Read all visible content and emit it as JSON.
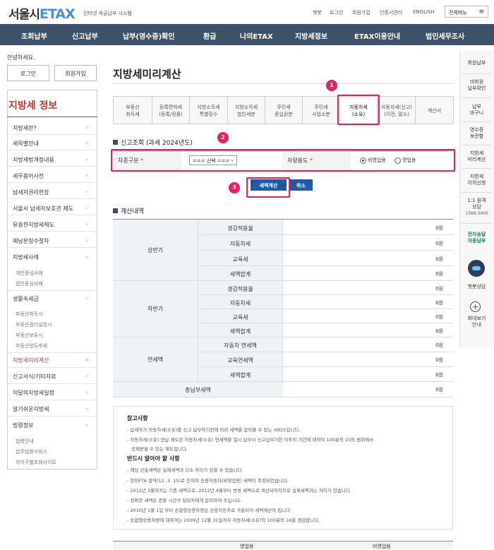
{
  "header": {
    "logo_main": "서울시",
    "logo_etax": "ETAX",
    "logo_sub": "인터넷 세금납부 시스템",
    "links": [
      "챗봇",
      "로그인",
      "회원가입",
      "인증서관리",
      "ENGLISH"
    ],
    "all_menu": "전체메뉴"
  },
  "gnb": [
    "조회납부",
    "신고납부",
    "납부(영수증)확인",
    "환급",
    "나의ETAX",
    "지방세정보",
    "ETAX이용안내",
    "법인세무조사"
  ],
  "sidebar": {
    "greeting": "안녕하세요.",
    "login": "로그인",
    "join": "회원가입",
    "title": "지방세 정보",
    "items": [
      "지방세란?",
      "세목별안내",
      "지방세법개정내용",
      "세무용어사전",
      "납세자권리헌장",
      "서울시 납세자보호관 제도",
      "유용한지방세제도",
      "체납분징수절차",
      "지방세사례"
    ],
    "sub1": [
      "개인중심사례",
      "법인중심사례"
    ],
    "item_living": "생활속세금",
    "sub2": [
      "부동산취득시",
      "부동산권리설정시",
      "부동산보유시",
      "부동산양도후세"
    ],
    "items2": [
      "지방세미리계산",
      "신고서식/기타자료",
      "이달의지방세일정",
      "알기쉬운지방세",
      "법령정보"
    ],
    "sub3": [
      "법령안내",
      "법무법령서비스",
      "자치구별조례사이트"
    ]
  },
  "page": {
    "title": "지방세미리계산",
    "tabs": [
      [
        "부동산",
        "취득세"
      ],
      [
        "등록면허세",
        "(등록/정률)"
      ],
      [
        "지방소득세",
        "특별징수"
      ],
      [
        "지방소득세",
        "법인세분"
      ],
      [
        "주민세",
        "종업원분"
      ],
      [
        "주민세",
        "사업소분"
      ],
      [
        "자동차세",
        "(소유)"
      ],
      [
        "자동차세(신고)",
        "(이전, 말소)"
      ],
      [
        "계산서",
        ""
      ]
    ],
    "badges": [
      "1",
      "2",
      "3"
    ],
    "inquiry_title": "신고조회 (과세 2024년도)",
    "car_type_label": "차종구분",
    "car_type_select": "=== 선택 ===",
    "car_use_label": "차량용도",
    "radio_options": [
      "비영업용",
      "영업용"
    ],
    "calc_btn": "세액계산",
    "cancel_btn": "취소",
    "calc_title": "계산내역",
    "groups": [
      {
        "name": "상반기",
        "rows": [
          "경감적용율",
          "자동차세",
          "교육세",
          "세액합계"
        ]
      },
      {
        "name": "하반기",
        "rows": [
          "경감적용율",
          "자동차세",
          "교육세",
          "세액합계"
        ]
      },
      {
        "name": "연세액",
        "rows": [
          "자동차 연세액",
          "교육연세액",
          "세액합계"
        ]
      }
    ],
    "total_label": "총납부세액",
    "zero": "0원",
    "notes_title": "참고사항",
    "notes": [
      "납세자가 자동차세(소유)를 신고 납부하기전에 미리 세액을 알아볼 수 있는 서비스입니다.",
      "자동차세(소유) 연납 제도란 자동차세(소유) 연세액을 일시 납부시 신고납부기한 이후의 기간에 대하여 100분의 10의 범위에서",
      "공제받을 수 있는 제도입니다."
    ],
    "notes2_title": "반드시 알아야 할 사항",
    "notes2": [
      "해당 산출세액은 실제세액과 다소 차이가 있을 수 있습니다.",
      "한미FTA 협약(12. 3. 15)로 인하여 승용자동차(비영업용) 세액이 조정되었습니다.",
      "2012년 3월까지는 기존 세액으로, 2012년 4월부터 변경 세액으로 계산되어지므로 실제세액과는 차이가 있습니다.",
      "정확한 세액은 관할 시군구 담당자에게 문의하여 주십시오.",
      "2010년 1월 1일 부터 승합형승용차량은 승용자동차로 구분되어 세액계산이 됩니다.",
      "승합형승용차량에 대하여는 2009년 12월 31일까지 자동차세(소유)의 100분의 16을 경감합니다."
    ],
    "bottom_headers": [
      "영업용",
      "비영업용"
    ]
  },
  "rightbar": [
    [
      "회원납부"
    ],
    [
      "비회원",
      "납부확인"
    ],
    [
      "납부",
      "바구니"
    ],
    [
      "영수증",
      "보관함"
    ],
    [
      "지방세",
      "미리계산"
    ],
    [
      "지방세",
      "이의신청"
    ],
    [
      "1:1 원격",
      "상담",
      "1566-3900"
    ],
    [
      "전자송달",
      "자동납부"
    ],
    [
      "챗봇상담"
    ],
    [
      "화대보기",
      "안내"
    ]
  ]
}
